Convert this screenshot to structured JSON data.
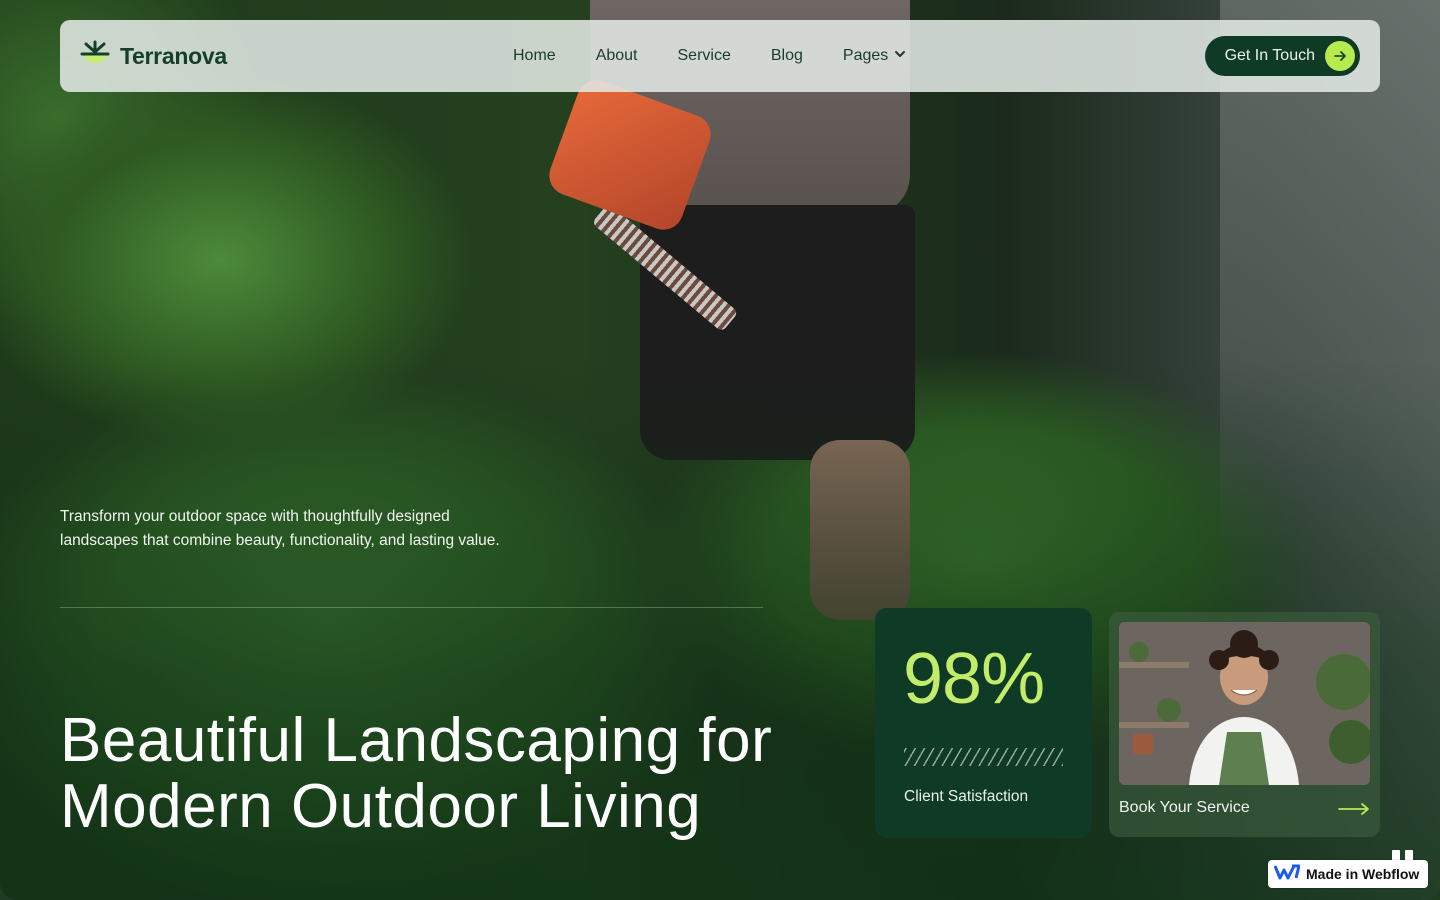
{
  "nav": {
    "brand": "Terranova",
    "links": [
      {
        "label": "Home"
      },
      {
        "label": "About"
      },
      {
        "label": "Service"
      },
      {
        "label": "Blog"
      },
      {
        "label": "Pages"
      }
    ],
    "cta_label": "Get In Touch"
  },
  "hero": {
    "description": "Transform your outdoor space with thoughtfully designed landscapes that combine beauty, functionality, and lasting value.",
    "title_line1": "Beautiful Landscaping for",
    "title_line2": "Modern Outdoor Living"
  },
  "stat_card": {
    "value": "98%",
    "label": "Client Satisfaction"
  },
  "service_card": {
    "label": "Book Your Service"
  },
  "badge": {
    "label": "Made in Webflow"
  },
  "colors": {
    "brand_dark": "#0f3a26",
    "accent_lime": "#b6ea4f",
    "stat_value": "#c3ec6a"
  },
  "icons": {
    "brand": "sprout-logo-icon",
    "pages_dropdown": "chevron-down-icon",
    "cta": "arrow-right-icon",
    "service": "arrow-right-long-icon",
    "badge": "webflow-logo-icon",
    "media": "pause-icon"
  }
}
